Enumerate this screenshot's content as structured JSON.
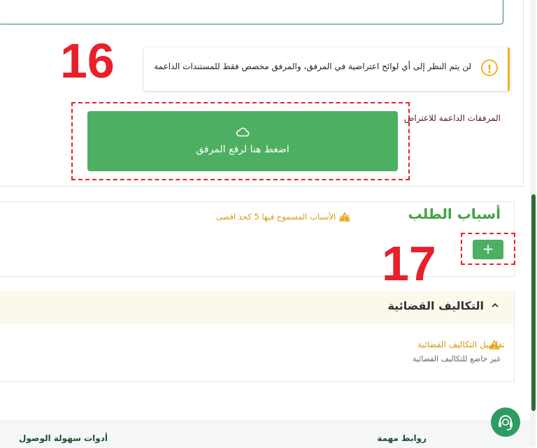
{
  "colors": {
    "primary_green": "#4caf61",
    "title_green": "#43a047",
    "warning": "#f0b323",
    "annotation_red": "#e8202a",
    "scroll_thumb": "#2f6e3a"
  },
  "annotations": {
    "a16": "16",
    "a17": "17"
  },
  "notice": {
    "icon": "exclamation-circle-icon",
    "icon_glyph": "!",
    "text": "لن يتم النظر إلى أي لوائح اعتراضية في المرفق، والمرفق مخصص فقط للمستندات الداعمة"
  },
  "upload": {
    "label": "المرفقات الداعمة للاعتراض",
    "button_text": "اضغط هنا لرفع المرفق",
    "icon": "cloud-upload-icon"
  },
  "reasons": {
    "title": "أسباب الطلب",
    "note": "عدد الأسباب المسموح فيها 5 كحد اقصى",
    "warn_icon": "warning-triangle-icon",
    "add_label": "+"
  },
  "costs": {
    "title": "التكاليف القضائية",
    "chevron_icon": "chevron-up-icon",
    "detail_label": "تفاصيل التكاليف القضائية",
    "detail_value": "غير خاضع للتكاليف القضائية"
  },
  "footer": {
    "links_title": "روابط مهمة",
    "accessibility_title": "أدوات سهولة الوصول"
  },
  "support": {
    "icon": "headset-support-icon"
  }
}
